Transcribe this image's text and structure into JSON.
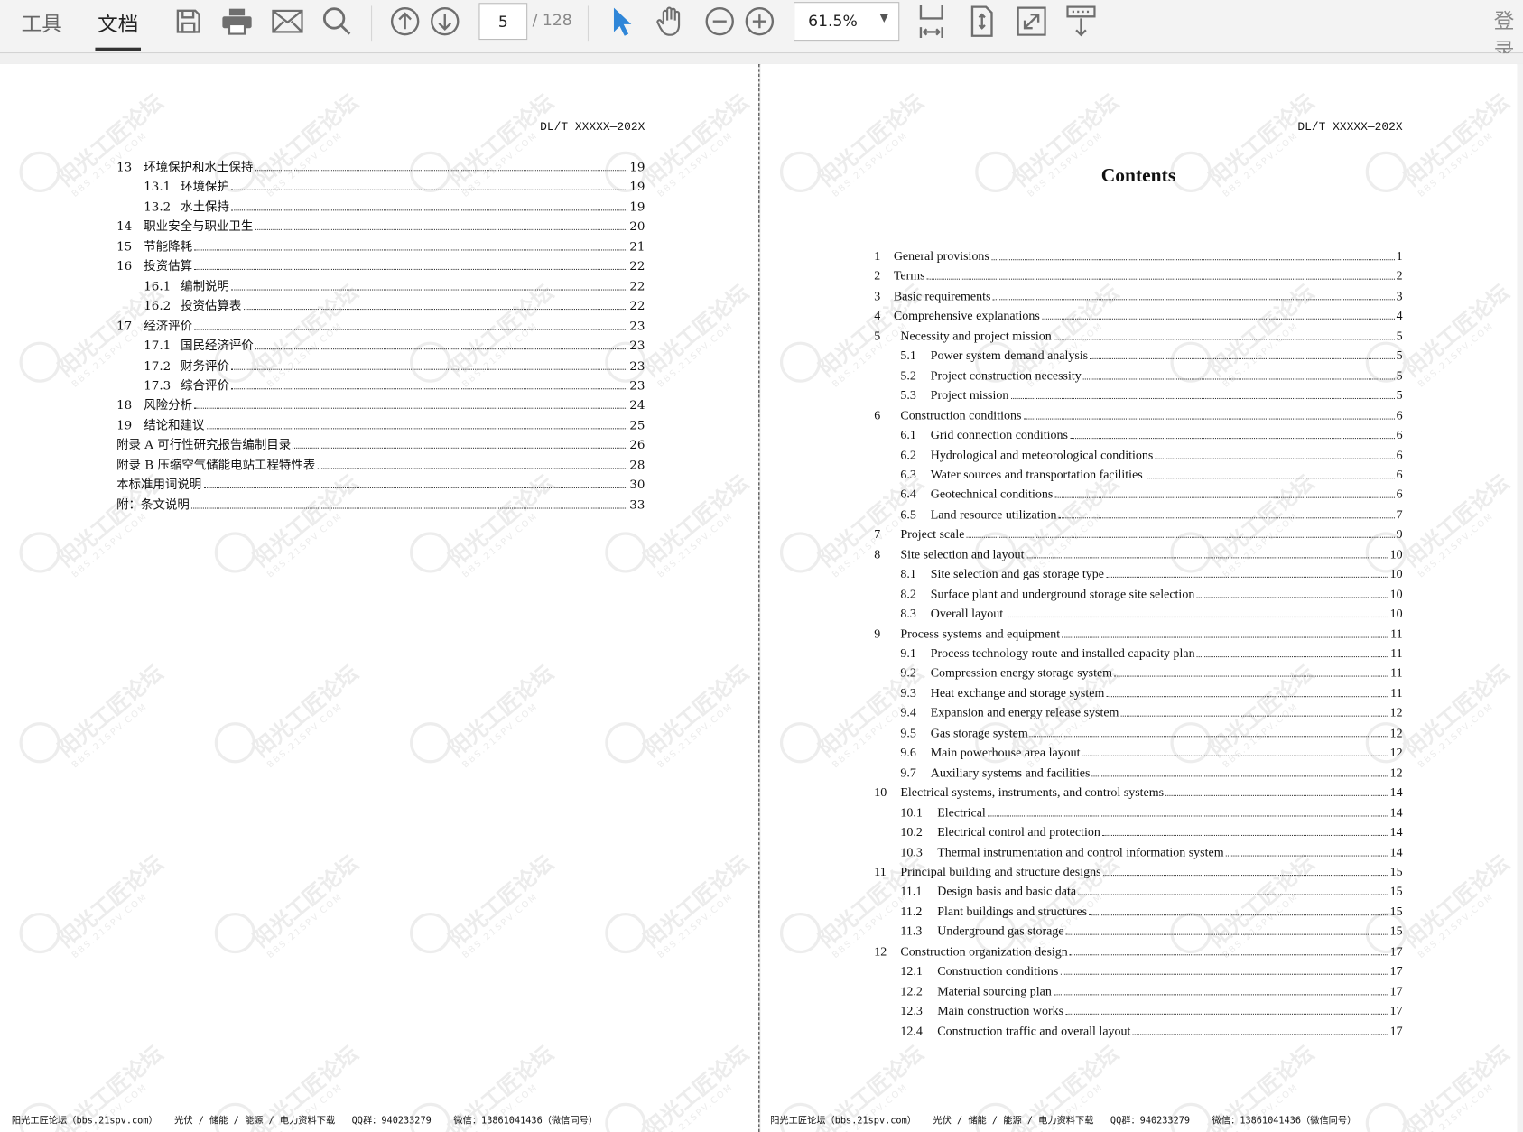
{
  "toolbar": {
    "tabs": [
      {
        "label": "工具",
        "active": false
      },
      {
        "label": "文档",
        "active": true
      }
    ],
    "icons": [
      "save-icon",
      "print-icon",
      "mail-icon",
      "search-icon",
      "page-up-icon",
      "page-down-icon",
      "select-cursor-icon",
      "hand-tool-icon",
      "zoom-out-icon",
      "zoom-in-icon",
      "fit-width-icon",
      "fit-page-icon",
      "fullscreen-icon",
      "download-icon"
    ],
    "current_page": "5",
    "total_pages": "/ 128",
    "zoom_level": "61.5%",
    "login_label": "登录",
    "accent_color": "#2f86d8"
  },
  "watermark": {
    "text": "阳光工匠论坛",
    "sub": "BBS.21SPV.COM"
  },
  "left_page": {
    "header": "DL/T XXXXX—202X",
    "toc": [
      {
        "num": "13",
        "title": "环境保护和水土保持",
        "page": "19",
        "level": 1
      },
      {
        "num": "13.1",
        "title": "环境保护",
        "page": "19",
        "level": 2
      },
      {
        "num": "13.2",
        "title": "水土保持",
        "page": "19",
        "level": 2
      },
      {
        "num": "14",
        "title": "职业安全与职业卫生",
        "page": "20",
        "level": 1
      },
      {
        "num": "15",
        "title": "节能降耗",
        "page": "21",
        "level": 1
      },
      {
        "num": "16",
        "title": "投资估算",
        "page": "22",
        "level": 1
      },
      {
        "num": "16.1",
        "title": "编制说明",
        "page": "22",
        "level": 2
      },
      {
        "num": "16.2",
        "title": "投资估算表",
        "page": "22",
        "level": 2
      },
      {
        "num": "17",
        "title": "经济评价",
        "page": "23",
        "level": 1
      },
      {
        "num": "17.1",
        "title": "国民经济评价",
        "page": "23",
        "level": 2
      },
      {
        "num": "17.2",
        "title": "财务评价",
        "page": "23",
        "level": 2
      },
      {
        "num": "17.3",
        "title": "综合评价",
        "page": "23",
        "level": 2
      },
      {
        "num": "18",
        "title": "风险分析",
        "page": "24",
        "level": 1
      },
      {
        "num": "19",
        "title": "结论和建议",
        "page": "25",
        "level": 1
      },
      {
        "num": "",
        "title": "附录 A  可行性研究报告编制目录",
        "page": "26",
        "level": 0
      },
      {
        "num": "",
        "title": "附录 B  压缩空气储能电站工程特性表",
        "page": "28",
        "level": 0
      },
      {
        "num": "",
        "title": "本标准用词说明",
        "page": "30",
        "level": 0
      },
      {
        "num": "",
        "title": "附：条文说明",
        "page": "33",
        "level": 0
      }
    ],
    "footer": "阳光工匠论坛（bbs.21spv.com）   光伏 / 储能 / 能源 / 电力资料下载   QQ群：940233279    微信：13861041436（微信同号）"
  },
  "right_page": {
    "header": "DL/T XXXXX—202X",
    "title": "Contents",
    "toc": [
      {
        "num": "1",
        "title": "General provisions",
        "page": "1",
        "level": 0
      },
      {
        "num": "2",
        "title": "Terms",
        "page": "2",
        "level": 0
      },
      {
        "num": "3",
        "title": "Basic requirements",
        "page": "3",
        "level": 0
      },
      {
        "num": "4",
        "title": "Comprehensive explanations",
        "page": "4",
        "level": 0
      },
      {
        "num": "5",
        "title": "Necessity and project mission",
        "page": "5",
        "level": 1
      },
      {
        "num": "5.1",
        "title": "Power system demand analysis",
        "page": "5",
        "level": 2
      },
      {
        "num": "5.2",
        "title": "Project construction necessity",
        "page": "5",
        "level": 2
      },
      {
        "num": "5.3",
        "title": "Project mission",
        "page": "5",
        "level": 2
      },
      {
        "num": "6",
        "title": "Construction conditions",
        "page": "6",
        "level": 1
      },
      {
        "num": "6.1",
        "title": "Grid connection conditions",
        "page": "6",
        "level": 2
      },
      {
        "num": "6.2",
        "title": "Hydrological and meteorological conditions",
        "page": "6",
        "level": 2
      },
      {
        "num": "6.3",
        "title": "Water sources and transportation facilities",
        "page": "6",
        "level": 2
      },
      {
        "num": "6.4",
        "title": "Geotechnical conditions",
        "page": "6",
        "level": 2
      },
      {
        "num": "6.5",
        "title": "Land resource utilization",
        "page": "7",
        "level": 2
      },
      {
        "num": "7",
        "title": "Project scale",
        "page": "9",
        "level": 1
      },
      {
        "num": "8",
        "title": "Site selection and layout",
        "page": "10",
        "level": 1
      },
      {
        "num": "8.1",
        "title": "Site selection and gas storage type",
        "page": "10",
        "level": 2
      },
      {
        "num": "8.2",
        "title": "Surface plant and underground storage site selection",
        "page": "10",
        "level": 2
      },
      {
        "num": "8.3",
        "title": "Overall layout",
        "page": "10",
        "level": 2
      },
      {
        "num": "9",
        "title": "Process systems and equipment",
        "page": "11",
        "level": 1
      },
      {
        "num": "9.1",
        "title": "Process technology route and installed capacity plan",
        "page": "11",
        "level": 2
      },
      {
        "num": "9.2",
        "title": "Compression energy storage system",
        "page": "11",
        "level": 2
      },
      {
        "num": "9.3",
        "title": "Heat exchange and storage system",
        "page": "11",
        "level": 2
      },
      {
        "num": "9.4",
        "title": "Expansion and energy release system",
        "page": "12",
        "level": 2
      },
      {
        "num": "9.5",
        "title": "Gas storage system",
        "page": "12",
        "level": 2
      },
      {
        "num": "9.6",
        "title": "Main powerhouse area layout",
        "page": "12",
        "level": 2
      },
      {
        "num": "9.7",
        "title": "Auxiliary systems and facilities",
        "page": "12",
        "level": 2
      },
      {
        "num": "10",
        "title": "Electrical systems, instruments, and control systems",
        "page": "14",
        "level": 1
      },
      {
        "num": "10.1",
        "title": "Electrical",
        "page": "14",
        "level": 3
      },
      {
        "num": "10.2",
        "title": "Electrical control and protection",
        "page": "14",
        "level": 3
      },
      {
        "num": "10.3",
        "title": "Thermal instrumentation and control information system",
        "page": "14",
        "level": 3
      },
      {
        "num": "11",
        "title": "Principal building and structure designs",
        "page": "15",
        "level": 1
      },
      {
        "num": "11.1",
        "title": "Design basis and basic data",
        "page": "15",
        "level": 3
      },
      {
        "num": "11.2",
        "title": "Plant buildings and structures",
        "page": "15",
        "level": 3
      },
      {
        "num": "11.3",
        "title": "Underground gas storage",
        "page": "15",
        "level": 3
      },
      {
        "num": "12",
        "title": "Construction organization design",
        "page": "17",
        "level": 1
      },
      {
        "num": "12.1",
        "title": "Construction conditions",
        "page": "17",
        "level": 3
      },
      {
        "num": "12.2",
        "title": "Material sourcing plan",
        "page": "17",
        "level": 3
      },
      {
        "num": "12.3",
        "title": "Main construction works",
        "page": "17",
        "level": 3
      },
      {
        "num": "12.4",
        "title": "Construction traffic and overall layout",
        "page": "17",
        "level": 3
      }
    ],
    "footer": "阳光工匠论坛（bbs.21spv.com）   光伏 / 储能 / 能源 / 电力资料下载   QQ群：940233279    微信：13861041436（微信同号）"
  }
}
